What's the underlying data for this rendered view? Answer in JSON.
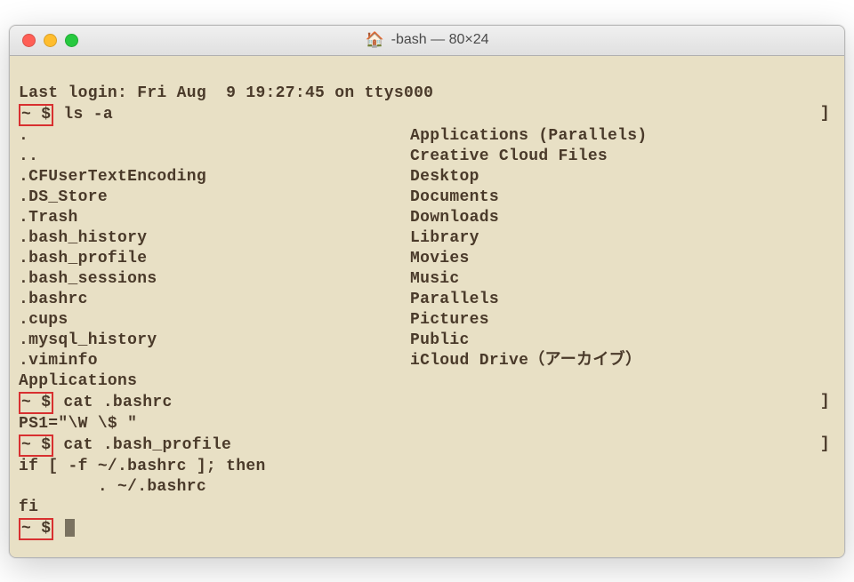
{
  "window": {
    "title": "-bash — 80×24"
  },
  "session": {
    "last_login": "Last login: Fri Aug  9 19:27:45 on ttys000",
    "prompt": "~ $",
    "right_bracket": "]"
  },
  "commands": {
    "ls": "ls -a",
    "cat_bashrc": "cat .bashrc",
    "cat_bash_profile": "cat .bash_profile"
  },
  "ls_output": {
    "left": [
      ".",
      "..",
      ".CFUserTextEncoding",
      ".DS_Store",
      ".Trash",
      ".bash_history",
      ".bash_profile",
      ".bash_sessions",
      ".bashrc",
      ".cups",
      ".mysql_history",
      ".viminfo",
      "Applications"
    ],
    "right": [
      "Applications (Parallels)",
      "Creative Cloud Files",
      "Desktop",
      "Documents",
      "Downloads",
      "Library",
      "Movies",
      "Music",
      "Parallels",
      "Pictures",
      "Public",
      "iCloud Drive（アーカイブ）",
      ""
    ]
  },
  "bashrc_output": "PS1=\"\\W \\$ \"",
  "bash_profile_output": {
    "l1": "if [ -f ~/.bashrc ]; then",
    "l2": "        . ~/.bashrc",
    "l3": "fi"
  }
}
